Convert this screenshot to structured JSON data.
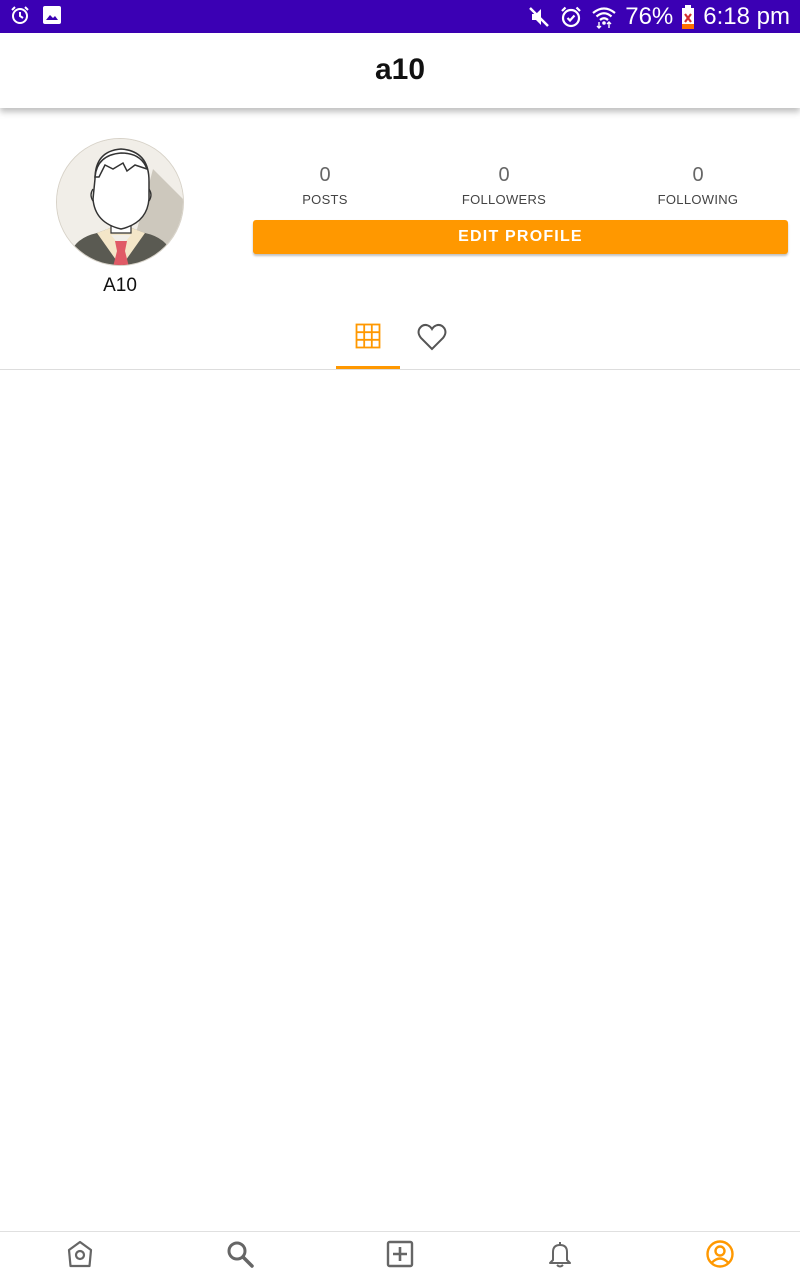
{
  "status_bar": {
    "battery": "76%",
    "time": "6:18 pm",
    "icons": [
      "alarm-icon",
      "gallery-icon",
      "mute-icon",
      "alarm-icon",
      "wifi-icon",
      "battery-icon"
    ]
  },
  "app_bar": {
    "title": "a10"
  },
  "profile": {
    "display_name": "A10",
    "avatar": "default-avatar",
    "stats": {
      "posts": {
        "value": "0",
        "label": "POSTS"
      },
      "followers": {
        "value": "0",
        "label": "FOLLOWERS"
      },
      "following": {
        "value": "0",
        "label": "FOLLOWING"
      }
    },
    "edit_button_label": "EDIT PROFILE"
  },
  "tabs": [
    {
      "icon": "grid-icon",
      "active": true
    },
    {
      "icon": "heart-icon",
      "active": false
    }
  ],
  "bottom_nav": [
    {
      "icon": "home-icon",
      "active": false
    },
    {
      "icon": "search-icon",
      "active": false
    },
    {
      "icon": "add-post-icon",
      "active": false
    },
    {
      "icon": "bell-icon",
      "active": false
    },
    {
      "icon": "profile-icon",
      "active": true
    }
  ],
  "colors": {
    "status_bar": "#3b00b4",
    "accent": "#ff9800",
    "icon_inactive": "#666666"
  }
}
